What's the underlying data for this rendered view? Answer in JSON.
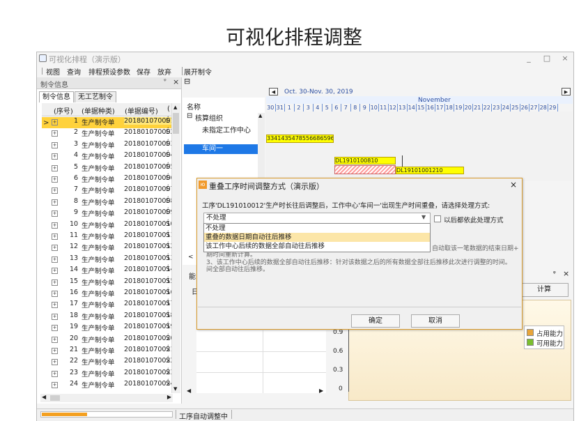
{
  "page_title": "可视化排程调整",
  "window": {
    "title": "可视化排程（演示版）",
    "minimize": "_",
    "maximize": "□",
    "close": "×"
  },
  "menu": {
    "items": [
      "视图",
      "查询",
      "排程预设参数",
      "保存",
      "放弃",
      "展开制令"
    ]
  },
  "left_panel": {
    "title": "制令信息",
    "pin": "ᵠ",
    "close": "×",
    "tabs": [
      "制令信息",
      "无工艺制令"
    ],
    "headers": [
      "(序号)",
      "(单据种类)",
      "(单据编号)",
      "("
    ],
    "rows": [
      {
        "n": "1",
        "type": "生产制令单",
        "code": "201801070001",
        "extra": "Ś"
      },
      {
        "n": "2",
        "type": "生产制令单",
        "code": "201801070002",
        "extra": "Ś"
      },
      {
        "n": "3",
        "type": "生产制令单",
        "code": "201801070003",
        "extra": "Ś"
      },
      {
        "n": "4",
        "type": "生产制令单",
        "code": "201801070004",
        "extra": "Ś"
      },
      {
        "n": "5",
        "type": "生产制令单",
        "code": "201801070005",
        "extra": "Ś"
      },
      {
        "n": "6",
        "type": "生产制令单",
        "code": "201801070006",
        "extra": "Ś"
      },
      {
        "n": "7",
        "type": "生产制令单",
        "code": "201801070007",
        "extra": "Ś"
      },
      {
        "n": "8",
        "type": "生产制令单",
        "code": "201801070008",
        "extra": "Ś"
      },
      {
        "n": "9",
        "type": "生产制令单",
        "code": "201801070009",
        "extra": "Ś"
      },
      {
        "n": "10",
        "type": "生产制令单",
        "code": "201801070010",
        "extra": "Ś"
      },
      {
        "n": "11",
        "type": "生产制令单",
        "code": "201801070011",
        "extra": "Ś"
      },
      {
        "n": "12",
        "type": "生产制令单",
        "code": "201801070012",
        "extra": "Ś"
      },
      {
        "n": "13",
        "type": "生产制令单",
        "code": "201801070013",
        "extra": "Ś"
      },
      {
        "n": "14",
        "type": "生产制令单",
        "code": "201801070014",
        "extra": "Ś"
      },
      {
        "n": "15",
        "type": "生产制令单",
        "code": "201801070015",
        "extra": "Ś"
      },
      {
        "n": "16",
        "type": "生产制令单",
        "code": "201801070016",
        "extra": "Ś"
      },
      {
        "n": "17",
        "type": "生产制令单",
        "code": "201801070017",
        "extra": "Ś"
      },
      {
        "n": "18",
        "type": "生产制令单",
        "code": "201801070018",
        "extra": "Ś"
      },
      {
        "n": "19",
        "type": "生产制令单",
        "code": "201801070019",
        "extra": "Ś"
      },
      {
        "n": "20",
        "type": "生产制令单",
        "code": "201801070020",
        "extra": "Ś"
      },
      {
        "n": "21",
        "type": "生产制令单",
        "code": "201801070021",
        "extra": "Ś"
      },
      {
        "n": "22",
        "type": "生产制令单",
        "code": "201801070022",
        "extra": "Ś"
      },
      {
        "n": "23",
        "type": "生产制令单",
        "code": "201801070023",
        "extra": "Ś"
      },
      {
        "n": "24",
        "type": "生产制令单",
        "code": "201801070024",
        "extra": "Ś"
      }
    ],
    "selected_row": 1
  },
  "gantt": {
    "collapse_toggle": "⊟",
    "range_label": "Oct. 30-Nov. 30, 2019",
    "month": "November",
    "days": [
      "30",
      "31",
      "1",
      "2",
      "3",
      "4",
      "5",
      "6",
      "7",
      "8",
      "9",
      "10",
      "11",
      "12",
      "13",
      "14",
      "15",
      "16",
      "17",
      "18",
      "19",
      "20",
      "21",
      "22",
      "23",
      "24",
      "25",
      "26",
      "27",
      "28",
      "29"
    ],
    "name_header": "名称",
    "tree": [
      {
        "label": "核算组织",
        "toggle": "⊟"
      },
      {
        "label": "未指定工作中心"
      },
      {
        "label": "车间一"
      }
    ],
    "bars": [
      "33414354785566865961​0",
      "DL19101008​10",
      "DL19101001​2​10"
    ]
  },
  "dialog": {
    "icon": "ю",
    "title": "重叠工序时间调整方式（演示版）",
    "close": "×",
    "message": "工序'DL191010012'生产时长往后调整后，工作中心'车间一'出现生产时间重叠，请选择处理方式:",
    "selected": "不处理",
    "options": [
      "不处理",
      "重叠的数据日期自动往后推移",
      "该工作中心后续的数据全部自动往后推移"
    ],
    "highlighted_option": 1,
    "checkbox_label": "以后都依此处理方式",
    "notes": [
      "自动取该一笔数据的结束日期+",
      "期时间重新计算。",
      "3、该工作中心后续的数据全部自动往后推移：针对该数据之后的所有数据全部往后推移此次进行调整的时间。",
      "间全部自动往后推移。"
    ],
    "ok": "确定",
    "cancel": "取消"
  },
  "bottom_panel": {
    "label_short": "能",
    "label_r": "日",
    "pin": "ᵠ",
    "close": "×",
    "calc": "计算",
    "y_ticks": [
      "0.9",
      "0.6",
      "0.3",
      "0"
    ],
    "legend": [
      {
        "name": "占用能力",
        "color": "#e8a53a"
      },
      {
        "name": "可用能力",
        "color": "#7bbf2e"
      }
    ]
  },
  "status": {
    "progress": 0.35,
    "text": "工序自动调整中"
  }
}
